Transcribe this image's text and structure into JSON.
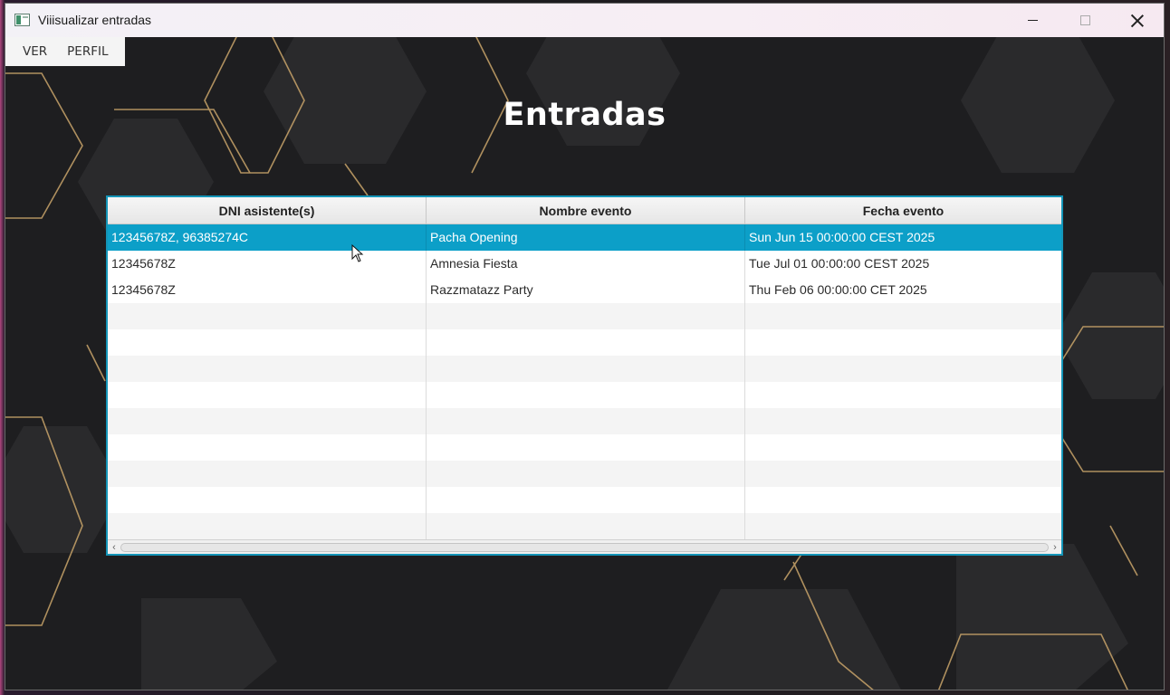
{
  "window": {
    "title": "Viiisualizar entradas",
    "icon": "app-window-icon",
    "controls": {
      "minimize": "minimize-icon",
      "maximize": "maximize-icon",
      "close": "close-icon"
    }
  },
  "menu": {
    "items": [
      {
        "label": "VER"
      },
      {
        "label": "PERFIL"
      }
    ]
  },
  "page": {
    "title": "Entradas"
  },
  "table": {
    "columns": [
      "DNI asistente(s)",
      "Nombre evento",
      "Fecha evento"
    ],
    "rows": [
      {
        "dni": "12345678Z, 96385274C",
        "evento": "Pacha Opening",
        "fecha": "Sun Jun 15 00:00:00 CEST 2025",
        "selected": true
      },
      {
        "dni": "12345678Z",
        "evento": "Amnesia Fiesta",
        "fecha": "Tue Jul 01 00:00:00 CEST 2025",
        "selected": false
      },
      {
        "dni": "12345678Z",
        "evento": "Razzmatazz Party",
        "fecha": "Thu Feb 06 00:00:00 CET 2025",
        "selected": false
      }
    ],
    "empty_rows": 9
  },
  "colors": {
    "selection": "#0c9fc8",
    "table_border": "#1495b8",
    "accent_gold": "#c9a46a"
  }
}
